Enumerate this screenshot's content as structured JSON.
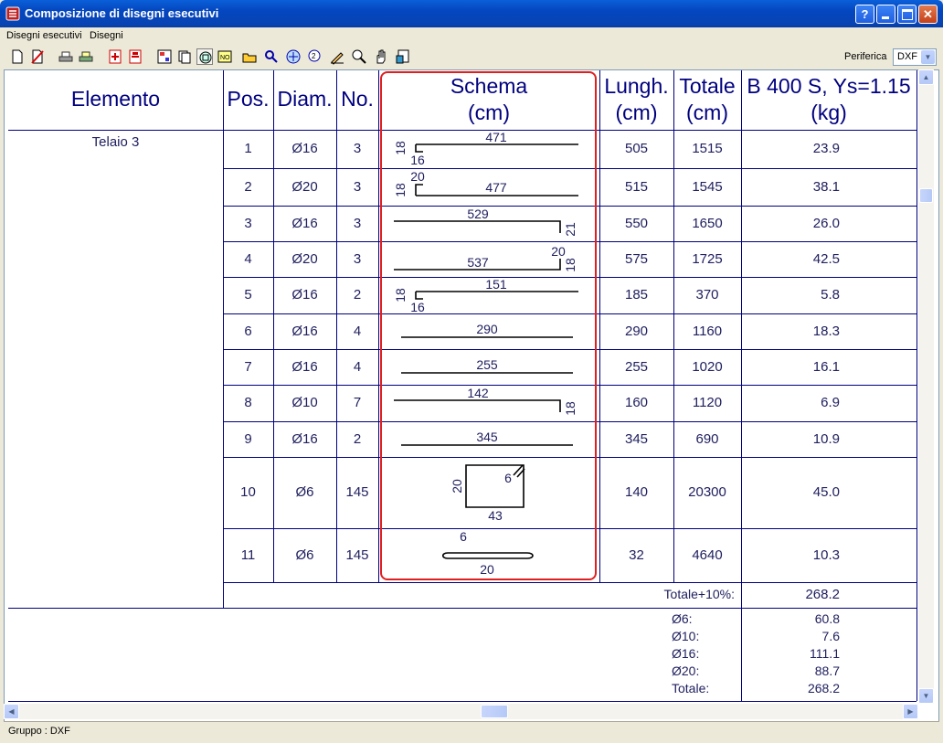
{
  "window": {
    "title": "Composizione di disegni esecutivi"
  },
  "menu": [
    "Disegni esecutivi",
    "Disegni"
  ],
  "toolbar": {
    "icons": [
      "new-icon",
      "delete-icon",
      "print-icon",
      "print-setup-icon",
      "add-drawing-icon",
      "remove-drawing-icon",
      "layout-icon",
      "copy-icon",
      "zoom-window-icon",
      "page-icon",
      "open-icon",
      "pan-icon",
      "zoom-all-icon",
      "zoom-in-icon",
      "edit-icon",
      "find-icon",
      "hand-icon",
      "export-icon"
    ],
    "periferica_label": "Periferica",
    "periferica_value": "DXF"
  },
  "table": {
    "headers": {
      "elemento": "Elemento",
      "pos": "Pos.",
      "diam": "Diam.",
      "no": "No.",
      "schema_1": "Schema",
      "schema_2": "(cm)",
      "lungh_1": "Lungh.",
      "lungh_2": "(cm)",
      "totale_1": "Totale",
      "totale_2": "(cm)",
      "peso_1": "B 400 S, Ys=1.15",
      "peso_2": "(kg)"
    },
    "element_name": "Telaio 3",
    "rows": [
      {
        "pos": "1",
        "diam": "Ø16",
        "no": "3",
        "lungh": "505",
        "totale": "1515",
        "peso": "23.9",
        "shape": "hook-left",
        "labels": [
          "471",
          "18",
          "16"
        ]
      },
      {
        "pos": "2",
        "diam": "Ø20",
        "no": "3",
        "lungh": "515",
        "totale": "1545",
        "peso": "38.1",
        "shape": "up-left",
        "labels": [
          "477",
          "18",
          "20"
        ]
      },
      {
        "pos": "3",
        "diam": "Ø16",
        "no": "3",
        "lungh": "550",
        "totale": "1650",
        "peso": "26.0",
        "shape": "down-right",
        "labels": [
          "529",
          "21"
        ]
      },
      {
        "pos": "4",
        "diam": "Ø20",
        "no": "3",
        "lungh": "575",
        "totale": "1725",
        "peso": "42.5",
        "shape": "up-right",
        "labels": [
          "537",
          "18",
          "20"
        ]
      },
      {
        "pos": "5",
        "diam": "Ø16",
        "no": "2",
        "lungh": "185",
        "totale": "370",
        "peso": "5.8",
        "shape": "hook-left",
        "labels": [
          "151",
          "18",
          "16"
        ]
      },
      {
        "pos": "6",
        "diam": "Ø16",
        "no": "4",
        "lungh": "290",
        "totale": "1160",
        "peso": "18.3",
        "shape": "straight",
        "labels": [
          "290"
        ]
      },
      {
        "pos": "7",
        "diam": "Ø16",
        "no": "4",
        "lungh": "255",
        "totale": "1020",
        "peso": "16.1",
        "shape": "straight",
        "labels": [
          "255"
        ]
      },
      {
        "pos": "8",
        "diam": "Ø10",
        "no": "7",
        "lungh": "160",
        "totale": "1120",
        "peso": "6.9",
        "shape": "down-right",
        "labels": [
          "142",
          "18"
        ]
      },
      {
        "pos": "9",
        "diam": "Ø16",
        "no": "2",
        "lungh": "345",
        "totale": "690",
        "peso": "10.9",
        "shape": "straight",
        "labels": [
          "345"
        ]
      },
      {
        "pos": "10",
        "diam": "Ø6",
        "no": "145",
        "lungh": "140",
        "totale": "20300",
        "peso": "45.0",
        "shape": "stirrup",
        "labels": [
          "43",
          "20",
          "6"
        ]
      },
      {
        "pos": "11",
        "diam": "Ø6",
        "no": "145",
        "lungh": "32",
        "totale": "4640",
        "peso": "10.3",
        "shape": "tie",
        "labels": [
          "20",
          "6"
        ]
      }
    ],
    "totale_label": "Totale+10%:",
    "totale_value": "268.2",
    "summary": [
      {
        "label": "Ø6:",
        "value": "60.8"
      },
      {
        "label": "Ø10:",
        "value": "7.6"
      },
      {
        "label": "Ø16:",
        "value": "111.1"
      },
      {
        "label": "Ø20:",
        "value": "88.7"
      },
      {
        "label": "Totale:",
        "value": "268.2"
      }
    ]
  },
  "status": {
    "text": "Gruppo : DXF"
  },
  "colors": {
    "title_bar": "#0446bf",
    "grid": "#00007f",
    "highlight": "#e02020",
    "text": "#202060"
  }
}
